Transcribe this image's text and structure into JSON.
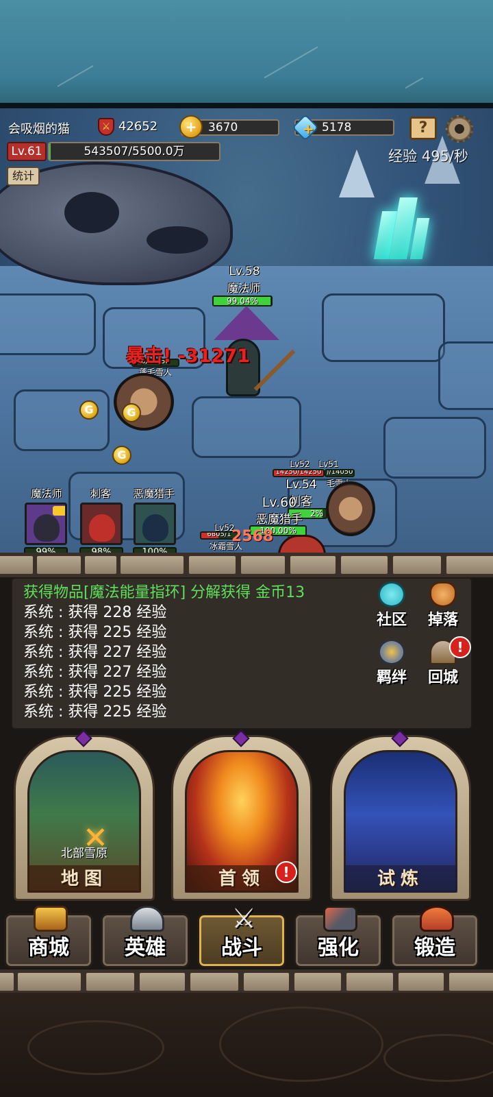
{
  "player": {
    "name": "会吸烟的猫",
    "power": "42652",
    "gold": "3670",
    "diamonds": "5178",
    "level": "Lv.61",
    "xp_text": "543507/5500.0万",
    "xp_fraction": 0.01,
    "xp_rate": "经验 495/秒",
    "stats_label": "统计"
  },
  "icons": {
    "power": "sword-shield-icon",
    "gold": "gold-coin-plus-icon",
    "diamond": "diamond-plus-icon",
    "guide": "question-book-icon",
    "settings": "gear-icon"
  },
  "battle": {
    "hero_main": {
      "level": "Lv.58",
      "name": "魔法师",
      "hp": "99.04%",
      "hp_fraction": 0.99
    },
    "enemy_left": {
      "hp_text": "0/14050",
      "name": "蓬毛雪人"
    },
    "crit_text": "暴击! -31271",
    "cluster": {
      "enemy_a": {
        "level": "Lv52",
        "hp": "14250/14250"
      },
      "enemy_b": {
        "level": "Lv51",
        "hp": ")/14050",
        "name": "毛雪人"
      },
      "hero_a": {
        "level": "Lv.54",
        "name": "刺客",
        "hp": "2%"
      },
      "hero_b": {
        "level": "Lv.60",
        "name": "恶魔猎手",
        "hp": "100.00%"
      },
      "enemy_c": {
        "level": "Lv52",
        "hp": "6805/1",
        "name": "冰霜雪人"
      },
      "damage": "2568"
    }
  },
  "party": [
    {
      "name": "魔法师",
      "hp": "99%"
    },
    {
      "name": "刺客",
      "hp": "98%"
    },
    {
      "name": "恶魔猎手",
      "hp": "100%"
    }
  ],
  "log": {
    "highlight": "获得物品[魔法能量指环] 分解获得 金币13",
    "lines": [
      "系统 : 获得 228 经验",
      "系统 : 获得 225 经验",
      "系统 : 获得 227 经验",
      "系统 : 获得 227 经验",
      "系统 : 获得 225 经验",
      "系统 : 获得 225 经验"
    ]
  },
  "side_buttons": {
    "community": "社区",
    "drops": "掉落",
    "bonds": "羁绊",
    "return_city": "回城",
    "alert": "!"
  },
  "cards": [
    {
      "label": "地图",
      "caption": "北部雪原"
    },
    {
      "label": "首领",
      "alert": "!"
    },
    {
      "label": "试炼"
    }
  ],
  "nav": [
    {
      "label": "商城",
      "icon": "treasure-chest-icon"
    },
    {
      "label": "英雄",
      "icon": "viking-helmet-icon"
    },
    {
      "label": "战斗",
      "icon": "crossed-swords-icon",
      "active": true
    },
    {
      "label": "强化",
      "icon": "hammer-anvil-icon"
    },
    {
      "label": "锻造",
      "icon": "forge-icon"
    }
  ],
  "colors": {
    "hp_green": "#3fd33b",
    "hp_red": "#d52d2d",
    "crit_red": "#e8231f",
    "log_green": "#5fe05a",
    "level_red": "#b5302b"
  }
}
